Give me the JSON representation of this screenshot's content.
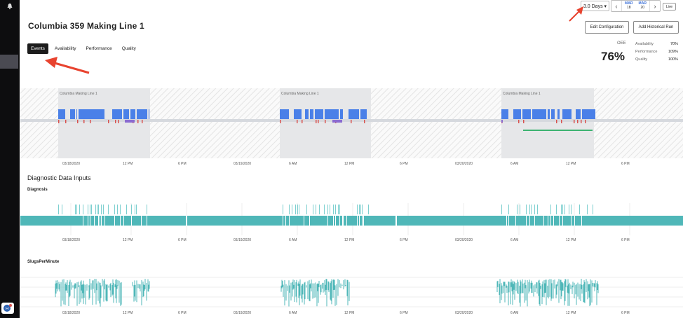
{
  "header": {
    "range_button": "3.0 Days ▾",
    "pager": {
      "from_month": "MAR",
      "from_day": "18",
      "to_month": "MAR",
      "to_day": "20"
    },
    "live_label": "Live"
  },
  "page": {
    "title": "Columbia 359 Making Line 1",
    "edit_button": "Edit Configuration",
    "add_button": "Add Historical Run",
    "tabs": [
      "Events",
      "Availability",
      "Performance",
      "Quality"
    ],
    "active_tab": "Events"
  },
  "oee": {
    "label": "OEE",
    "value": "76%",
    "metrics": [
      {
        "label": "Availability",
        "value": "70%"
      },
      {
        "label": "Performance",
        "value": "109%"
      },
      {
        "label": "Quality",
        "value": "100%"
      }
    ]
  },
  "events_chart": {
    "run_label": "Columbia Making Line 1",
    "x_ticks": [
      "03/18/2020",
      "12 PM",
      "6 PM",
      "03/19/2020",
      "6 AM",
      "12 PM",
      "6 PM",
      "03/20/2020",
      "6 AM",
      "12 PM",
      "6 PM"
    ]
  },
  "diagnostic": {
    "section_title": "Diagnostic Data Inputs",
    "diagnosis_title": "Diagnosis",
    "slugs_title": "SlugsPerMinute"
  },
  "colors": {
    "sidebar": "#0d0d0f",
    "run_blue": "#4a80e8",
    "fault_red": "#d9534f",
    "teal": "#4fb7b8",
    "green_line": "#3cb371",
    "annotation_arrow": "#e8432f"
  }
}
